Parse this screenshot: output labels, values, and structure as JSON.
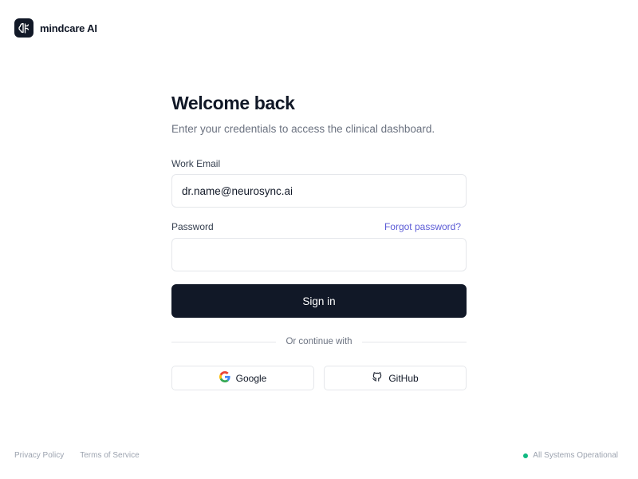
{
  "brand": {
    "name": "mindcare AI",
    "logo_icon": "brain-icon"
  },
  "login": {
    "title": "Welcome back",
    "subtitle": "Enter your credentials to access the clinical dashboard.",
    "email_label": "Work Email",
    "email_value": "dr.name@neurosync.ai",
    "password_label": "Password",
    "password_value": "",
    "forgot_label": "Forgot password?",
    "signin_label": "Sign in",
    "divider_label": "Or continue with",
    "google_label": "Google",
    "github_label": "GitHub"
  },
  "footer": {
    "privacy_label": "Privacy Policy",
    "terms_label": "Terms of Service",
    "status_label": "All Systems Operational"
  },
  "colors": {
    "primary": "#111827",
    "link": "#5b5bd6",
    "muted": "#6b7280",
    "border": "#e5e7eb",
    "status_ok": "#10b981"
  }
}
